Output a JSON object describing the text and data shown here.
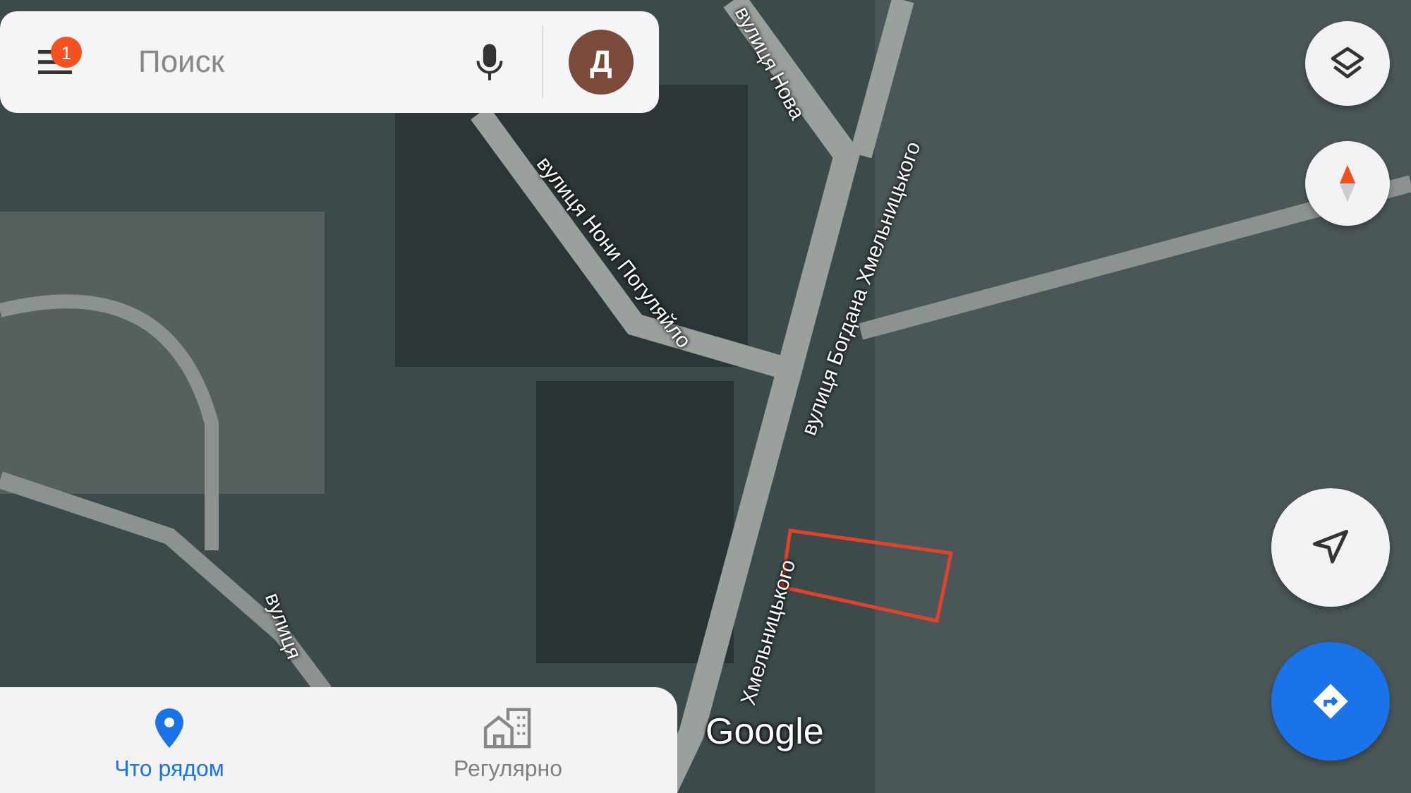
{
  "search": {
    "placeholder": "Поиск",
    "menu_badge": "1",
    "avatar_letter": "Д"
  },
  "map": {
    "street_labels": [
      {
        "text": "вулиця Нова",
        "kind": "steep"
      },
      {
        "text": "вулиця Нони Погуляйло",
        "kind": "diagonal"
      },
      {
        "text": "вулиця Богдана Хмельницького",
        "kind": "upright"
      },
      {
        "text": "Хмельницького",
        "kind": "lower"
      },
      {
        "text": "вулиця",
        "kind": "left"
      }
    ],
    "logo": "Google"
  },
  "tabs": [
    {
      "label": "Что рядом",
      "selected": true
    },
    {
      "label": "Регулярно",
      "selected": false
    }
  ]
}
